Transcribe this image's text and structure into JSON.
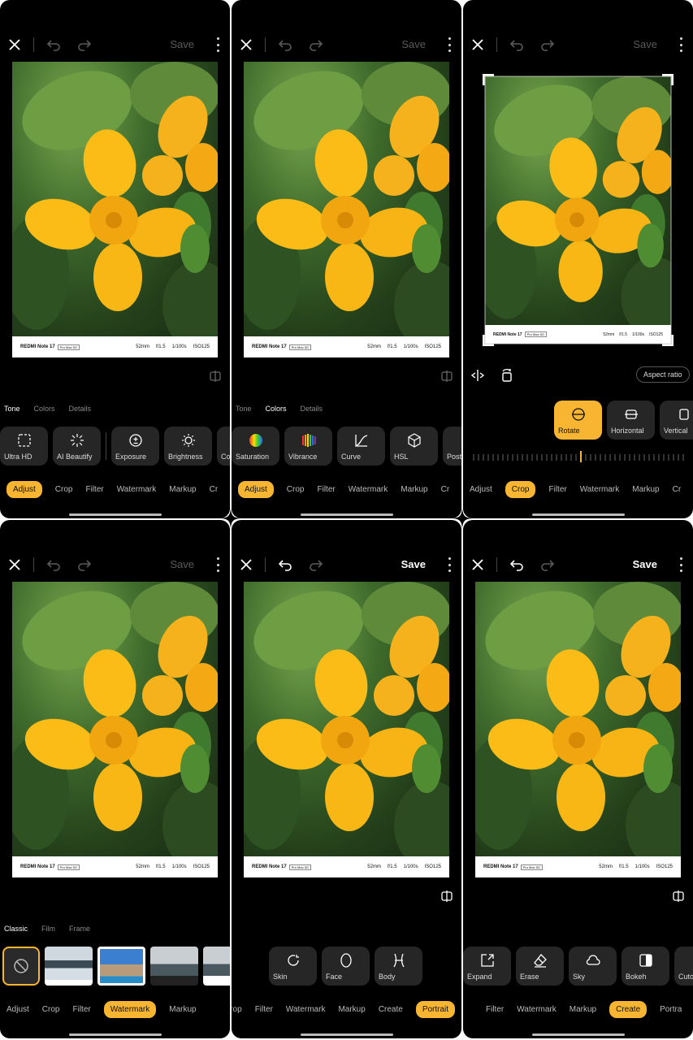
{
  "common": {
    "save_label": "Save",
    "caption": {
      "brand": "REDMI Note 17",
      "tag": "Pro Max 5G",
      "exif": [
        "52mm",
        "f/1.5",
        "1/100s",
        "ISO125"
      ]
    }
  },
  "panel1": {
    "subtabs": [
      "Tone",
      "Colors",
      "Details"
    ],
    "tools": [
      "Ultra HD",
      "AI Beautify",
      "Exposure",
      "Brightness",
      "Co"
    ],
    "nav": [
      "Adjust",
      "Crop",
      "Filter",
      "Watermark",
      "Markup",
      "Cr"
    ]
  },
  "panel2": {
    "subtabs": [
      "Tone",
      "Colors",
      "Details"
    ],
    "tools": [
      "Saturation",
      "Vibrance",
      "Curve",
      "HSL",
      "Post"
    ],
    "nav": [
      "Adjust",
      "Crop",
      "Filter",
      "Watermark",
      "Markup",
      "Cr"
    ]
  },
  "panel3": {
    "aspect_label": "Aspect ratio",
    "tools": [
      "Rotate",
      "Horizontal",
      "Vertical"
    ],
    "nav": [
      "Adjust",
      "Crop",
      "Filter",
      "Watermark",
      "Markup",
      "Cr"
    ]
  },
  "panel4": {
    "subtabs": [
      "Classic",
      "Film",
      "Frame"
    ],
    "nav": [
      "Adjust",
      "Crop",
      "Filter",
      "Watermark",
      "Markup"
    ]
  },
  "panel5": {
    "tools": [
      "Skin",
      "Face",
      "Body"
    ],
    "nav": [
      "Crop",
      "Filter",
      "Watermark",
      "Markup",
      "Create",
      "Portrait"
    ]
  },
  "panel6": {
    "tools": [
      "Expand",
      "Erase",
      "Sky",
      "Bokeh",
      "Cuto"
    ],
    "nav": [
      "Filter",
      "Watermark",
      "Markup",
      "Create",
      "Portra"
    ]
  },
  "colors": {
    "accent": "#f7b531",
    "panel_bg": "#000000",
    "tool_bg": "#262626"
  }
}
